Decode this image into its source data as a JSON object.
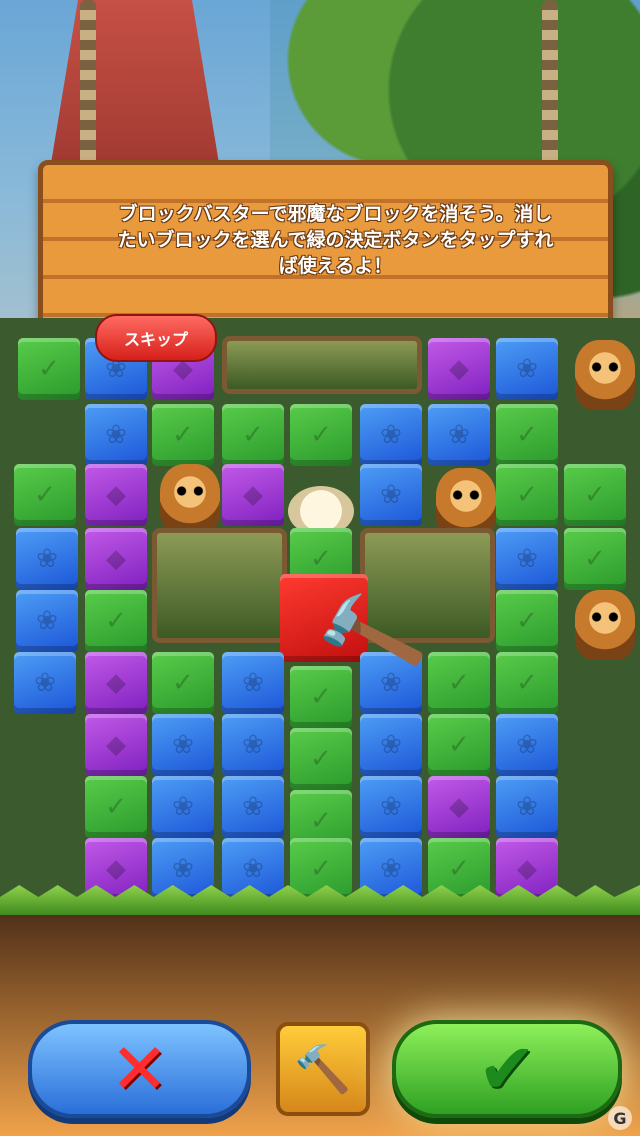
{
  "tutorial": {
    "message": "ブロックバスターで邪魔なブロックを消そう。消したいブロックを選んで緑の決定ボタンをタップすれば使えるよ！"
  },
  "skip_label": "スキップ",
  "tool": {
    "icon": "hammer-icon"
  },
  "buttons": {
    "cancel_icon": "x-icon",
    "confirm_icon": "check-icon"
  },
  "watermark": "G",
  "colors": {
    "green_block": "#3bb63a",
    "blue_block": "#2d70e6",
    "purple_block": "#a23ad8",
    "red_block": "#e0211c",
    "sign_wood": "#e99a3c",
    "skip_red": "#e02a22"
  }
}
